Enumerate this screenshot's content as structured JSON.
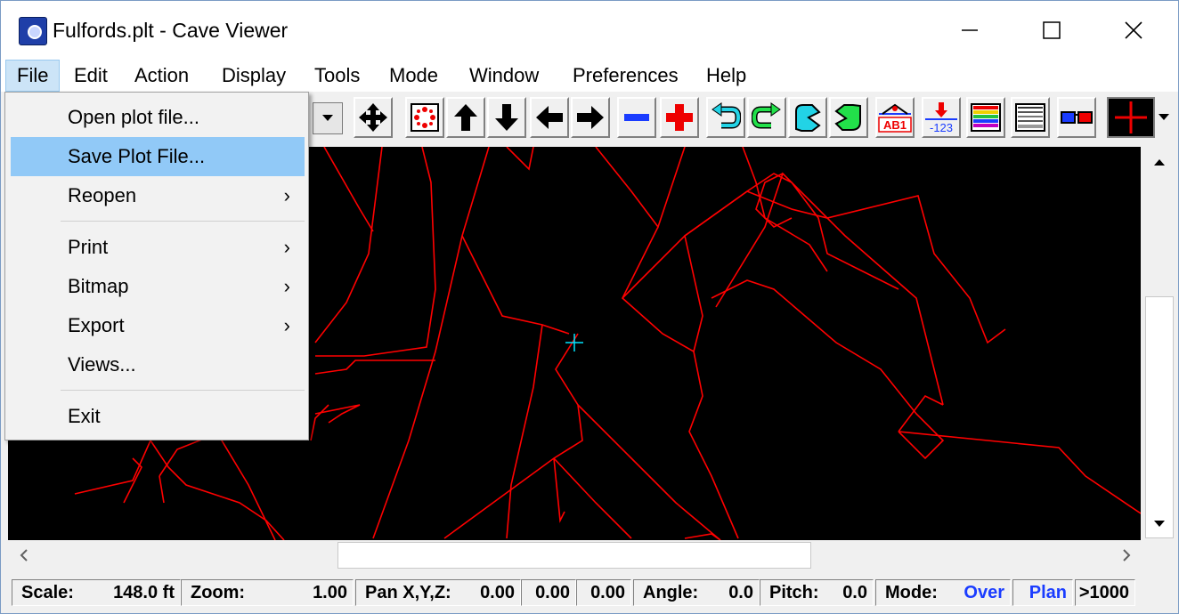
{
  "window": {
    "title": "Fulfords.plt - Cave Viewer"
  },
  "menubar": {
    "items": [
      {
        "label": "File"
      },
      {
        "label": "Edit"
      },
      {
        "label": "Action"
      },
      {
        "label": "Display"
      },
      {
        "label": "Tools"
      },
      {
        "label": "Mode"
      },
      {
        "label": "Window"
      },
      {
        "label": "Preferences"
      },
      {
        "label": "Help"
      }
    ]
  },
  "file_menu": {
    "items": [
      {
        "label": "Open plot file..."
      },
      {
        "label": "Save Plot File...",
        "highlighted": true
      },
      {
        "label": "Reopen",
        "submenu": true
      },
      {
        "label": "Print",
        "submenu": true
      },
      {
        "label": "Bitmap",
        "submenu": true
      },
      {
        "label": "Export",
        "submenu": true
      },
      {
        "label": "Views..."
      },
      {
        "label": "Exit"
      }
    ],
    "submenu_glyph": "›"
  },
  "toolbar": {
    "icons": [
      "pan-move-icon",
      "zoom-fit-icon",
      "pan-up-icon",
      "pan-down-icon",
      "pan-left-icon",
      "pan-right-icon",
      "zoom-out-icon",
      "zoom-in-icon",
      "rotate-left-icon",
      "rotate-right-icon",
      "tilt-up-icon",
      "tilt-down-icon",
      "station-labels-icon",
      "depth-values-icon",
      "color-bands-icon",
      "gray-bands-icon",
      "stereo-glasses-icon",
      "crosshair-icon"
    ],
    "ab1_label": "AB1",
    "depth_label": "-123"
  },
  "status": {
    "scale": {
      "label": "Scale:",
      "value": "148.0 ft"
    },
    "zoom": {
      "label": "Zoom:",
      "value": "1.00"
    },
    "pan": {
      "label": "Pan X,Y,Z:",
      "x": "0.00",
      "y": "0.00",
      "z": "0.00"
    },
    "angle": {
      "label": "Angle:",
      "value": "0.0"
    },
    "pitch": {
      "label": "Pitch:",
      "value": "0.0"
    },
    "mode": {
      "label": "Mode:",
      "value": "Over"
    },
    "view": "Plan",
    "count": ">1000"
  },
  "colors": {
    "plot_line": "#ff0000",
    "cursor": "#00e5ff",
    "menu_highlight": "#91c9f7",
    "status_blue": "#1a3cff"
  }
}
